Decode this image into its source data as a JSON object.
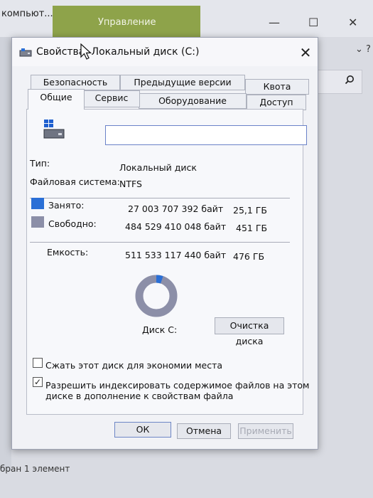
{
  "background": {
    "breadcrumb": "компьют...",
    "ribbon_tab": "Управление",
    "minimize": "—",
    "maximize": "☐",
    "close": "✕",
    "more": "⌄ ?",
    "search_icon": "search-icon",
    "status": "бран 1 элемент"
  },
  "dialog": {
    "title": "Свойства: Локальный диск (C:)",
    "close": "✕",
    "tabs_row1": [
      "Безопасность",
      "Предыдущие версии",
      "Квота"
    ],
    "tabs_row2": [
      "Общие",
      "Сервис",
      "Оборудование",
      "Доступ"
    ],
    "name_value": "",
    "type_label": "Тип:",
    "type_value": "Локальный диск",
    "fs_label": "Файловая система:",
    "fs_value": "NTFS",
    "used_label": "Занято:",
    "used_bytes": "27 003 707 392 байт",
    "used_size": "25,1 ГБ",
    "free_label": "Свободно:",
    "free_bytes": "484 529 410 048 байт",
    "free_size": "451 ГБ",
    "capacity_label": "Емкость:",
    "capacity_bytes": "511 533 117 440 байт",
    "capacity_size": "476 ГБ",
    "used_fraction": 0.0528,
    "disk_label": "Диск C:",
    "cleanup_button": "Очистка диска",
    "compress_label": "Сжать этот диск для экономии места",
    "compress_checked": false,
    "index_label_line1": "Разрешить индексировать содержимое файлов на этом",
    "index_label_line2": "диске в дополнение к свойствам файла",
    "index_checked": true,
    "ok": "ОК",
    "cancel": "Отмена",
    "apply": "Применить",
    "colors": {
      "used": "#2a6fd6",
      "free": "#8c8fa8"
    }
  }
}
